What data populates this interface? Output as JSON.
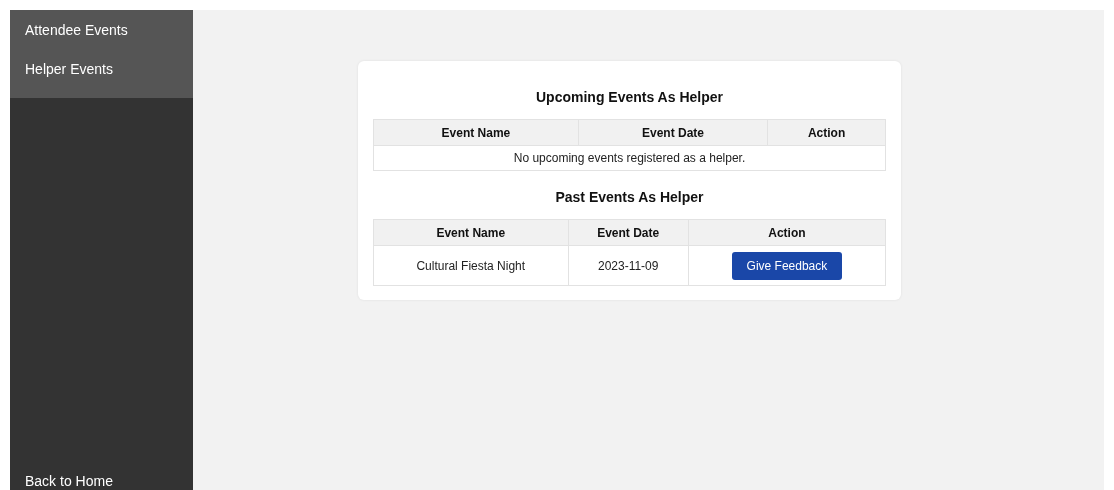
{
  "sidebar": {
    "items": [
      {
        "label": "Attendee Events"
      },
      {
        "label": "Helper Events"
      }
    ],
    "footer_link": "Back to Home"
  },
  "sections": [
    {
      "title": "Upcoming Events As Helper",
      "columns": [
        "Event Name",
        "Event Date",
        "Action"
      ],
      "empty_message": "No upcoming events registered as a helper."
    },
    {
      "title": "Past Events As Helper",
      "columns": [
        "Event Name",
        "Event Date",
        "Action"
      ],
      "rows": [
        {
          "name": "Cultural Fiesta Night",
          "date": "2023-11-09",
          "action": "Give Feedback"
        }
      ]
    }
  ]
}
